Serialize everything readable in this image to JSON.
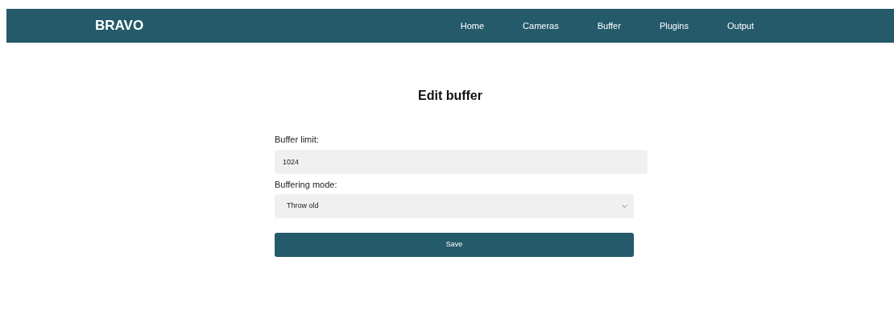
{
  "navbar": {
    "brand": "BRAVO",
    "links": [
      {
        "label": "Home"
      },
      {
        "label": "Cameras"
      },
      {
        "label": "Buffer"
      },
      {
        "label": "Plugins"
      },
      {
        "label": "Output"
      }
    ]
  },
  "title": "Edit buffer",
  "form": {
    "fields": [
      {
        "kind": "input",
        "label": "Buffer limit:",
        "value": "1024"
      },
      {
        "kind": "select",
        "label": "Buffering mode:",
        "value": "Throw old"
      }
    ],
    "submit": "Save"
  }
}
